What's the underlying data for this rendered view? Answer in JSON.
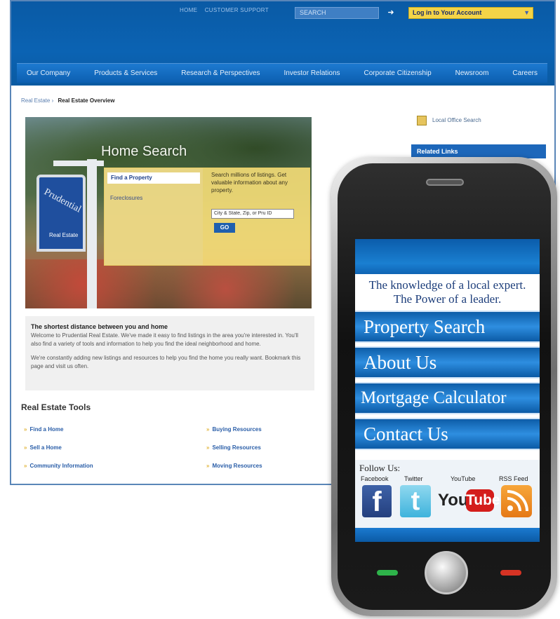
{
  "colors": {
    "brand_blue": "#0b63b3",
    "accent_yellow": "#f4d447",
    "link_blue": "#2a5ea8"
  },
  "site": {
    "top_nav": {
      "home": "HOME",
      "support": "CUSTOMER SUPPORT"
    },
    "search_placeholder": "SEARCH",
    "login_label": "Log in to Your Account",
    "main_nav": [
      "Our Company",
      "Products & Services",
      "Research & Perspectives",
      "Investor Relations",
      "Corporate Citizenship",
      "Newsroom",
      "Careers"
    ],
    "breadcrumb": {
      "parent": "Real Estate",
      "separator": "›",
      "current": "Real Estate Overview"
    },
    "hero": {
      "title": "Home Search",
      "sign_brand": "Prudential",
      "sign_sub": "Real Estate",
      "tab_find": "Find a Property",
      "tab_foreclosures": "Foreclosures",
      "panel_text": "Search millions of listings. Get valuable information about any property.",
      "input_placeholder": "City & State, Zip, or Pru ID",
      "go_label": "GO"
    },
    "intro": {
      "heading": "The shortest distance between you and home",
      "para1": "Welcome to Prudential Real Estate. We've made it easy to find listings in the area you're interested in. You'll also find a variety of tools and information to help you find the ideal neighborhood and home.",
      "para2": "We're constantly adding new listings and resources to help you find the home you really want. Bookmark this page and visit us often."
    },
    "tools": {
      "title": "Real Estate Tools",
      "links": [
        "Find a Home",
        "Sell a Home",
        "Community Information",
        "Buying Resources",
        "Selling Resources",
        "Moving Resources"
      ]
    },
    "sidebar": {
      "office_search": "Local Office Search",
      "related_links": "Related Links"
    }
  },
  "phone": {
    "tagline_line1": "The knowledge of a local expert.",
    "tagline_line2": "The Power of a leader.",
    "menu": [
      "Property Search",
      "About Us",
      "Mortgage Calculator",
      "Contact Us"
    ],
    "follow_label": "Follow Us:",
    "social": [
      {
        "label": "Facebook",
        "glyph": "f",
        "icon": "facebook-icon"
      },
      {
        "label": "Twitter",
        "glyph": "t",
        "icon": "twitter-icon"
      },
      {
        "label": "YouTube",
        "glyph_you": "You",
        "glyph_tube": "Tube",
        "icon": "youtube-icon"
      },
      {
        "label": "RSS Feed",
        "icon": "rss-icon"
      }
    ]
  }
}
